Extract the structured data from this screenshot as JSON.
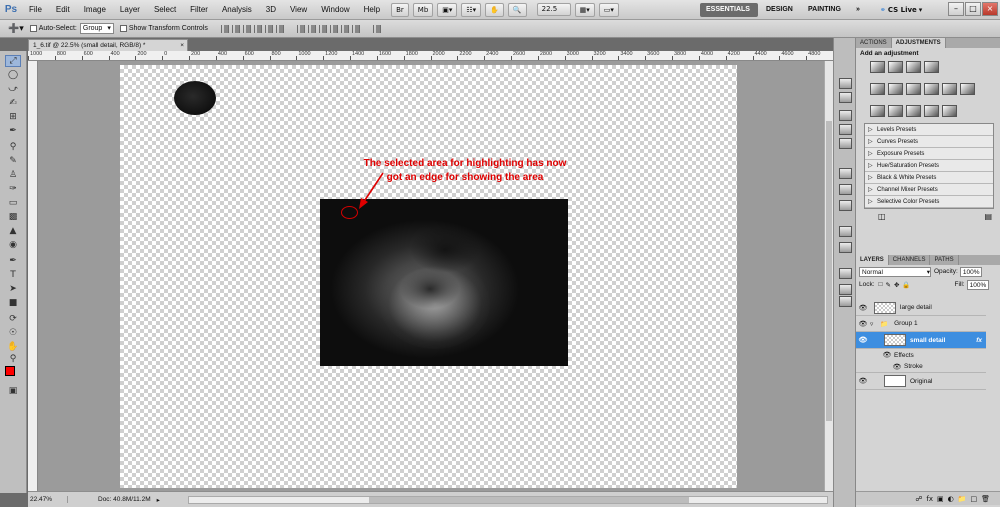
{
  "app": {
    "logo": "Ps"
  },
  "menu": [
    "File",
    "Edit",
    "Image",
    "Layer",
    "Select",
    "Filter",
    "Analysis",
    "3D",
    "View",
    "Window",
    "Help"
  ],
  "menubar": {
    "zoom_value": "22.5",
    "workspaces": [
      "ESSENTIALS",
      "DESIGN",
      "PAINTING",
      "»"
    ],
    "cslive": "CS Live"
  },
  "options": {
    "auto_select_label": "Auto-Select:",
    "auto_select_value": "Group",
    "transform_label": "Show Transform Controls"
  },
  "document": {
    "tab_title": "1_6.tif @ 22.5% (small detail, RGB/8) *",
    "annotation_line1": "The selected area for highlighting has now",
    "annotation_line2": "got an edge for showing the area"
  },
  "ruler_labels": [
    "1000",
    "800",
    "600",
    "400",
    "200",
    "0",
    "200",
    "400",
    "600",
    "800",
    "1000",
    "1200",
    "1400",
    "1600",
    "1800",
    "2000",
    "2200",
    "2400",
    "2600",
    "2800",
    "3000",
    "3200",
    "3400",
    "3600",
    "3800",
    "4000",
    "4200",
    "4400",
    "4600",
    "4800"
  ],
  "status": {
    "zoom": "22.47%",
    "doc": "Doc: 40.8M/11.2M"
  },
  "adjustments_panel": {
    "tabs": [
      "ACTIONS",
      "ADJUSTMENTS"
    ],
    "title": "Add an adjustment",
    "presets": [
      "Levels Presets",
      "Curves Presets",
      "Exposure Presets",
      "Hue/Saturation Presets",
      "Black & White Presets",
      "Channel Mixer Presets",
      "Selective Color Presets"
    ]
  },
  "layers_panel": {
    "tabs": [
      "LAYERS",
      "CHANNELS",
      "PATHS"
    ],
    "blend_mode": "Normal",
    "opacity_label": "Opacity:",
    "opacity_value": "100%",
    "lock_label": "Lock:",
    "fill_label": "Fill:",
    "fill_value": "100%",
    "layers": [
      "large detail",
      "Group 1",
      "small detail",
      "Effects",
      "Stroke",
      "Original"
    ]
  }
}
